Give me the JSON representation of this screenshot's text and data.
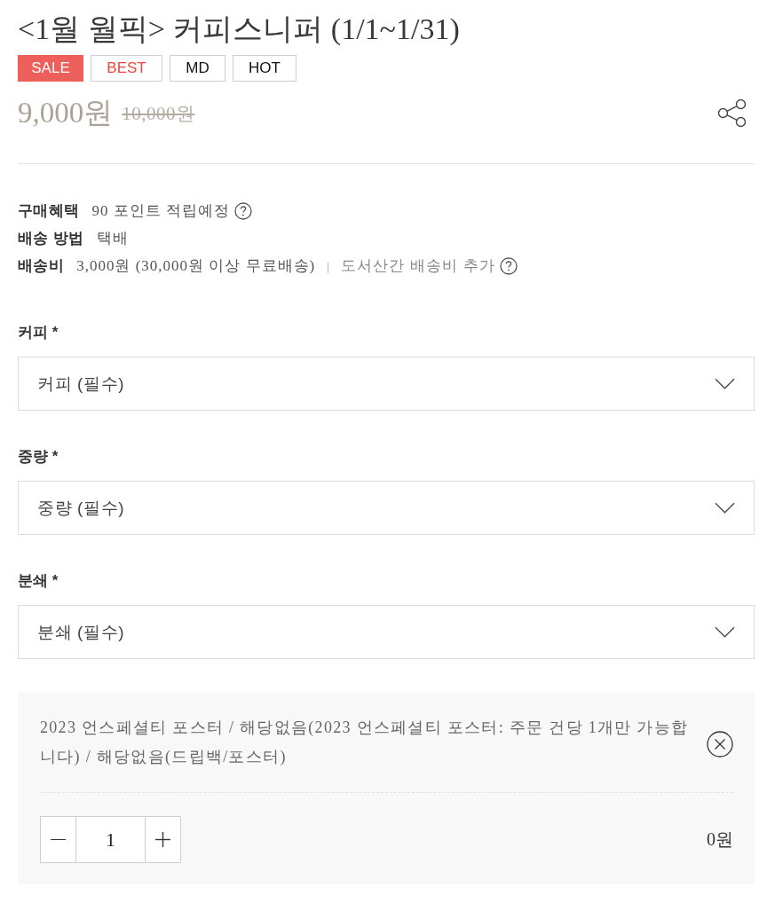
{
  "product": {
    "title": "<1월 월픽> 커피스니퍼 (1/1~1/31)",
    "badges": [
      {
        "label": "SALE",
        "kind": "filled",
        "color": "#ec5f5b"
      },
      {
        "label": "BEST",
        "kind": "outline",
        "color": "#e8483c"
      },
      {
        "label": "MD",
        "kind": "outline",
        "color": "#111111"
      },
      {
        "label": "HOT",
        "kind": "outline",
        "color": "#111111"
      }
    ],
    "price": {
      "sale": "9,000원",
      "original": "10,000원"
    }
  },
  "info": [
    {
      "label": "구매혜택",
      "value": "90 포인트 적립예정",
      "help": true
    },
    {
      "label": "배송 방법",
      "value": "택배",
      "help": false
    },
    {
      "label": "배송비",
      "value": "3,000원 (30,000원 이상 무료배송)",
      "note": "도서산간 배송비 추가",
      "help": true
    }
  ],
  "options": [
    {
      "label": "커피 *",
      "value": "커피 (필수)"
    },
    {
      "label": "중량 *",
      "value": "중량 (필수)"
    },
    {
      "label": "분쇄 *",
      "value": "분쇄 (필수)"
    }
  ],
  "selected_items": [
    {
      "description": "2023 언스페셜티 포스터 / 해당없음(2023 언스페셜티 포스터: 주문 건당 1개만 가능합니다) / 해당없음(드립백/포스터)",
      "quantity": "1",
      "price": "0원"
    }
  ]
}
